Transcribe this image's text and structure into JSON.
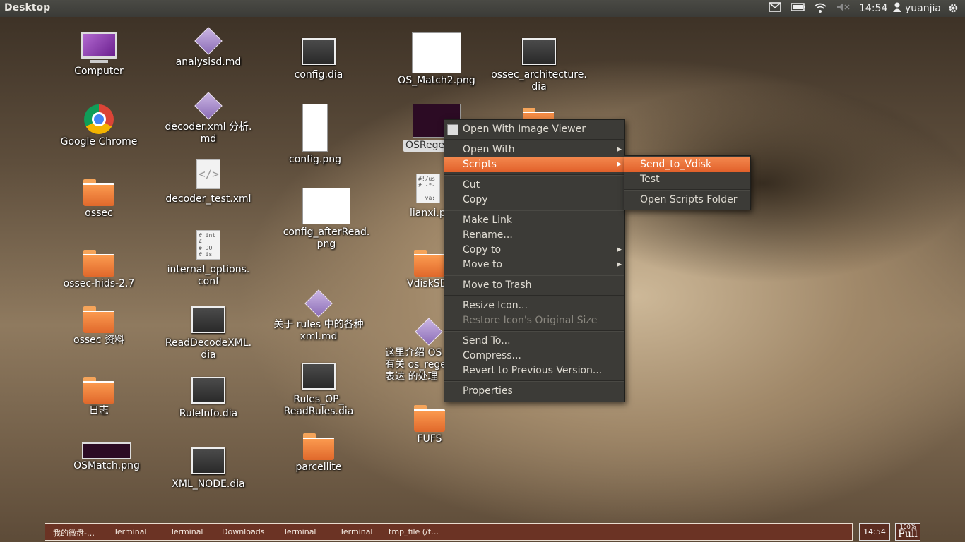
{
  "top_panel": {
    "title": "Desktop",
    "time": "14:54",
    "user": "yuanjia",
    "icons": [
      "mail-icon",
      "battery-icon",
      "wifi-icon",
      "volume-muted-icon",
      "user-icon",
      "gear-icon"
    ]
  },
  "desktop": {
    "col1": [
      "Computer",
      "Google Chrome",
      "ossec",
      "ossec-hids-2.7",
      "ossec 资料",
      "日志",
      "OSMatch.png"
    ],
    "col2": [
      "analysisd.md",
      "decoder.xml 分析.\nmd",
      "decoder_test.xml",
      "internal_options.\nconf",
      "ReadDecodeXML.\ndia",
      "RuleInfo.dia",
      "XML_NODE.dia"
    ],
    "col3": [
      "config.dia",
      "config.png",
      "config_afterRead.\npng",
      "关于 rules 中的各种\nxml.md",
      "Rules_OP_\nReadRules.dia",
      "parcellite"
    ],
    "col4": [
      "OS_Match2.png",
      "OSRege",
      "lianxi.p",
      "VdiskSD",
      "这里介绍 OS\n有关 os_rege\n表达 的处理",
      "FUFS"
    ],
    "col5": [
      "ossec_architecture.\ndia"
    ],
    "doc_snippets": {
      "internal": "# int\n#\n# DO\n# is",
      "lianxi": "#!/us\n# -*-\n\n  va:"
    }
  },
  "context_menu": {
    "items": [
      "Open With Image Viewer",
      "Open With",
      "Scripts",
      "Cut",
      "Copy",
      "Make Link",
      "Rename...",
      "Copy to",
      "Move to",
      "Move to Trash",
      "Resize Icon...",
      "Restore Icon's Original Size",
      "Send To...",
      "Compress...",
      "Revert to Previous Version...",
      "Properties"
    ]
  },
  "scripts_submenu": {
    "items": [
      "Send_to_Vdisk",
      "Test",
      "Open Scripts Folder"
    ]
  },
  "taskbar": {
    "tasks": [
      "我的微盘-…",
      "Terminal",
      "Terminal",
      "Downloads",
      "Terminal",
      "Terminal",
      "tmp_file (/t…"
    ],
    "clock": "14:54",
    "battery_percent": "100%",
    "battery_label": "Full"
  },
  "colors": {
    "accent": "#e9672f",
    "menu_bg": "#3c3b37",
    "taskbar": "#6b3324"
  }
}
